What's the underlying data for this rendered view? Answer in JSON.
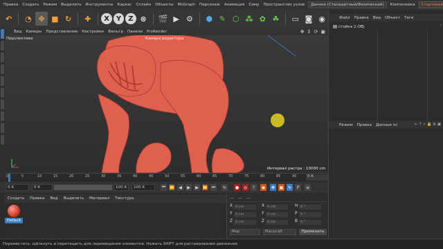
{
  "menu": {
    "items": [
      "Правка",
      "Создать",
      "Режим",
      "Выделить",
      "Инструменты",
      "Каркас",
      "Сплайн",
      "Объекты",
      "MoGraph",
      "Персонаж",
      "Анимация",
      "Симу",
      "Пространство узлов"
    ],
    "layout_dropdown": "Данное (Стандартный/Физический)",
    "right_items": [
      "Компоновка",
      "Стартовая"
    ]
  },
  "toolbar": {
    "xyz": [
      "X",
      "Y",
      "Z"
    ]
  },
  "viewport": {
    "menu_items": [
      "Вид",
      "Камеры",
      "Представление",
      "Настройки",
      "Фильтр",
      "Панели",
      "ProRender"
    ],
    "label": "Перспектива",
    "camera": "Камера редактора",
    "raster": "Интервал растра : 10000 cm",
    "accent": "#e06050"
  },
  "timeline": {
    "ticks": [
      "0",
      "5",
      "10",
      "15",
      "20",
      "25",
      "30",
      "35",
      "40",
      "45",
      "50",
      "55",
      "60",
      "65",
      "70",
      "75",
      "80",
      "85",
      "90"
    ],
    "current_frame": "0 K",
    "start": "0 K",
    "field2": "0 K",
    "end": "100 K",
    "end2": "100 K"
  },
  "materials": {
    "menu": [
      "Создать",
      "Правка",
      "Вид",
      "Выделить",
      "Материал",
      "Текстура"
    ],
    "items": [
      {
        "name": "Default"
      }
    ]
  },
  "coords": {
    "header": [
      "—",
      "—",
      "—"
    ],
    "rows": [
      {
        "a": "X",
        "av": "0 cm",
        "b": "X",
        "bv": "0 cm",
        "c": "H",
        "cv": "0 °"
      },
      {
        "a": "Y",
        "av": "0 cm",
        "b": "Y",
        "bv": "0 cm",
        "c": "P",
        "cv": "0 °"
      },
      {
        "a": "Z",
        "av": "0 cm",
        "b": "Z",
        "bv": "0 cm",
        "c": "B",
        "cv": "0 °"
      }
    ],
    "select1": "Мир",
    "select2": "Масштаб",
    "apply": "Применить"
  },
  "right_panel": {
    "object_menu": [
      "Файл",
      "Правка",
      "Вид",
      "Объект",
      "Теги"
    ],
    "object_name": "стойка 2.OBJ",
    "attr_menu": [
      "Режим",
      "Правка",
      "Данные пс"
    ]
  },
  "status": "Переместить: щёлкнуть и перетащить для перемещения элементов. Нажать SHIFT для растрирования движения."
}
